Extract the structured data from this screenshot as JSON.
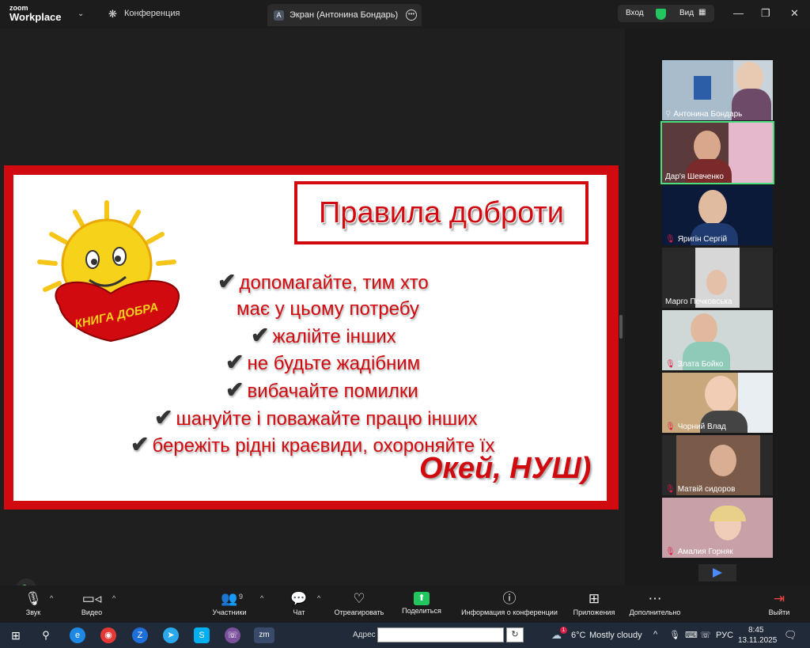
{
  "titlebar": {
    "logo_top": "zoom",
    "logo_bottom": "Workplace",
    "conference": "Конференция",
    "tab_letter": "А",
    "tab_title": "Экран (Антонина Бондарь)",
    "login": "Вход",
    "view": "Вид"
  },
  "slide": {
    "title": "Правила доброти",
    "heart_text": "КНИГА ДОБРА",
    "rules": [
      "допомагайте, тим хто",
      "має у цьому потребу",
      "жалійте інших",
      "не будьте жадібним",
      "вибачайте помилки",
      "шануйте і поважайте працю інших",
      "бережіть рідні краєвиди, охороняйте їх"
    ],
    "footer": "Окей, НУШ)"
  },
  "participants": [
    {
      "name": "Антонина Бондарь",
      "muted": false
    },
    {
      "name": "Дар'я Шевченко",
      "muted": false
    },
    {
      "name": "Яригін Сергій",
      "muted": true
    },
    {
      "name": "Марго Печковська",
      "muted": false
    },
    {
      "name": "Злата Бойко",
      "muted": true
    },
    {
      "name": "Чорний Влад",
      "muted": true
    },
    {
      "name": "Матвій сидоров",
      "muted": true
    },
    {
      "name": "Амалия Горняк",
      "muted": true
    }
  ],
  "toolbar": {
    "audio": "Звук",
    "video": "Видео",
    "participants": "Участники",
    "participants_count": "9",
    "chat": "Чат",
    "react": "Отреагировать",
    "share": "Поделиться",
    "info": "Информация о конференции",
    "apps": "Приложения",
    "more": "Дополнительно",
    "leave": "Выйти"
  },
  "taskbar": {
    "address_label": "Адрес",
    "address_value": "",
    "weather_temp": "6°C",
    "weather_text": "Mostly cloudy",
    "weather_badge": "1",
    "lang": "РУС",
    "time": "8:45",
    "date": "13.11.2025"
  },
  "colors": {
    "slide_red": "#d10a10",
    "share_green": "#22c55e",
    "active_outline": "#4ade80"
  }
}
